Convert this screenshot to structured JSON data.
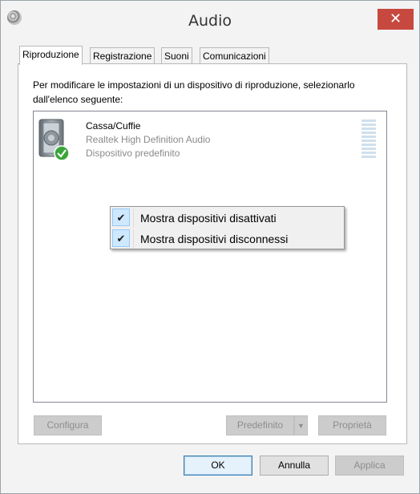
{
  "window": {
    "title": "Audio",
    "close_glyph": "✕"
  },
  "tabs": [
    {
      "label": "Riproduzione"
    },
    {
      "label": "Registrazione"
    },
    {
      "label": "Suoni"
    },
    {
      "label": "Comunicazioni"
    }
  ],
  "panel": {
    "instructions": "Per modificare le impostazioni di un dispositivo di riproduzione, selezionarlo dall'elenco seguente:",
    "device": {
      "name": "Cassa/Cuffie",
      "driver": "Realtek High Definition Audio",
      "status": "Dispositivo predefinito",
      "icon": "speaker-icon",
      "badge": "default-check-badge"
    }
  },
  "context_menu": {
    "items": [
      {
        "label": "Mostra dispositivi disattivati",
        "checked": true
      },
      {
        "label": "Mostra dispositivi disconnessi",
        "checked": true
      }
    ],
    "check_glyph": "✔"
  },
  "panel_buttons": {
    "configure": "Configura",
    "set_default": "Predefinito",
    "properties": "Proprietà"
  },
  "dialog_buttons": {
    "ok": "OK",
    "cancel": "Annulla",
    "apply": "Applica"
  },
  "colors": {
    "close_button": "#c7483e",
    "menu_check_bg": "#cde8ff",
    "badge_green": "#3aa53a"
  }
}
